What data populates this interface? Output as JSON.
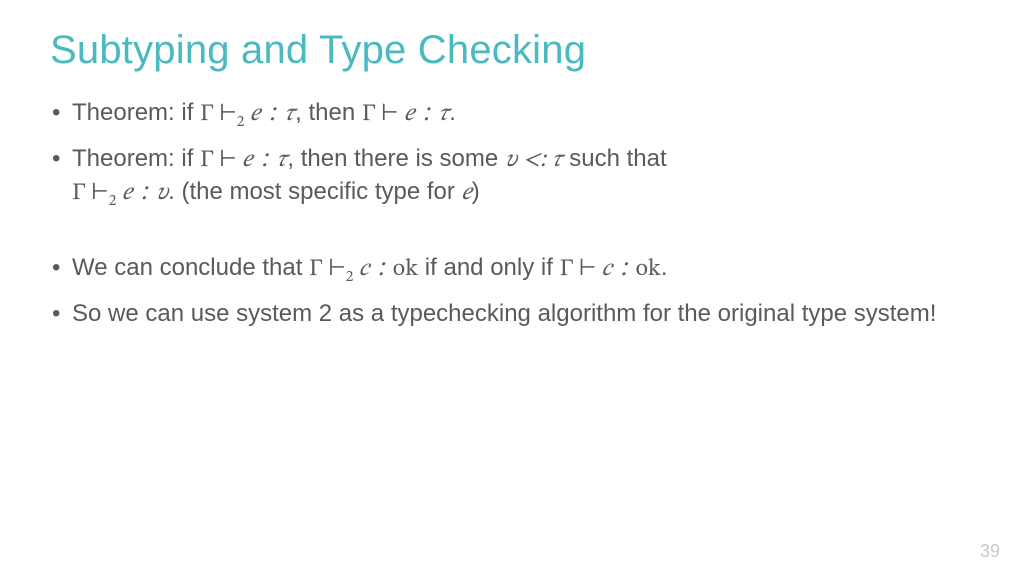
{
  "slide": {
    "title": "Subtyping and Type Checking",
    "page_number": "39",
    "bullets": [
      {
        "prefix": "Theorem: if ",
        "j1_ctx": "Γ",
        "j1_turn": " ⊢",
        "j1_sub": "2",
        "j1_rest": " 𝑒 ∶ 𝜏",
        "mid": ", then ",
        "j2_ctx": "Γ",
        "j2_turn": " ⊢ ",
        "j2_rest": "𝑒 ∶ 𝜏",
        "suffix": "."
      },
      {
        "prefix": "Theorem: if ",
        "j1_ctx": "Γ",
        "j1_turn": " ⊢ ",
        "j1_rest": "𝑒 ∶ 𝜏",
        "mid": ", then there is some ",
        "rel": "𝜐 <: 𝜏",
        "mid2": " such that",
        "line2_ctx": "Γ",
        "line2_turn": " ⊢",
        "line2_sub": "2",
        "line2_rest": " 𝑒 ∶ 𝜐",
        "line2_tail": ". (the most specific type for ",
        "line2_e": "𝑒",
        "line2_close": ")"
      },
      {
        "prefix": "We can conclude that ",
        "j1_ctx": "Γ",
        "j1_turn": " ⊢",
        "j1_sub": "2",
        "j1_rest": " 𝑐 ∶ ",
        "ok1": "ok",
        "mid": " if and only if ",
        "j2_ctx": "Γ",
        "j2_turn": " ⊢ ",
        "j2_rest": "𝑐 ∶ ",
        "ok2": "ok",
        "suffix": "."
      },
      {
        "text": "So we can use system 2 as a typechecking algorithm for the original type system!"
      }
    ]
  }
}
